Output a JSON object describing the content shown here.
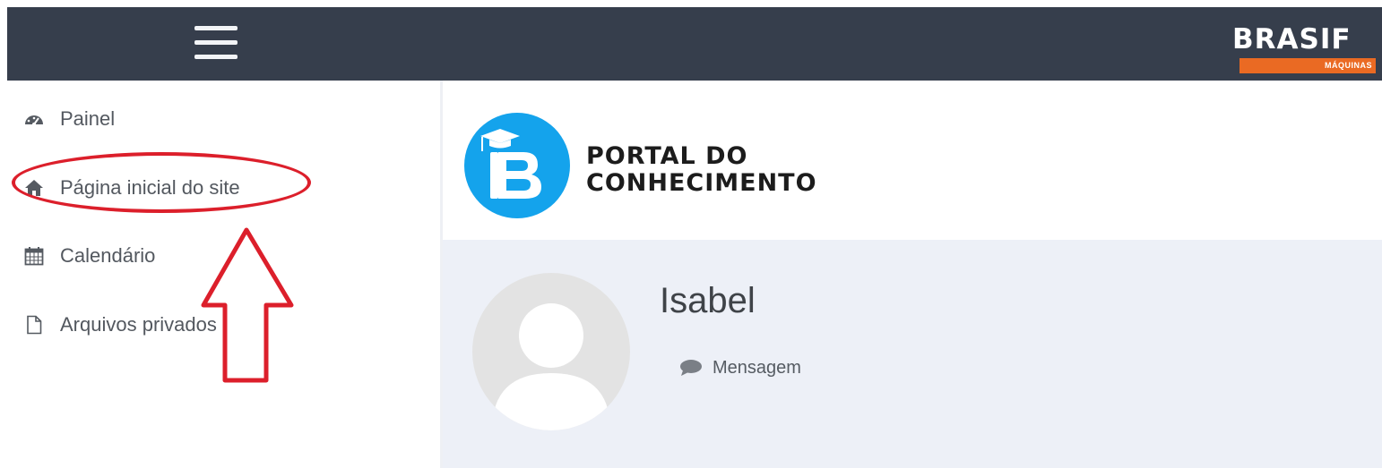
{
  "brand": {
    "name": "BRASIF",
    "subtitle": "MÁQUINAS",
    "accent_color": "#ea6a23",
    "navbar_color": "#363e4c"
  },
  "sidebar": {
    "items": [
      {
        "label": "Painel",
        "icon": "dashboard-icon"
      },
      {
        "label": "Página inicial do site",
        "icon": "home-icon"
      },
      {
        "label": "Calendário",
        "icon": "calendar-icon"
      },
      {
        "label": "Arquivos privados",
        "icon": "file-icon"
      }
    ]
  },
  "header": {
    "logo_letter": "B",
    "title_line1": "PORTAL DO",
    "title_line2": "CONHECIMENTO",
    "logo_color": "#14a3ec"
  },
  "profile": {
    "name": "Isabel",
    "message_label": "Mensagem",
    "avatar_icon": "default-user-avatar-icon",
    "message_icon": "speech-bubble-icon"
  },
  "annotation": {
    "color": "#dc1f2b",
    "highlighted_item": "Página inicial do site"
  }
}
